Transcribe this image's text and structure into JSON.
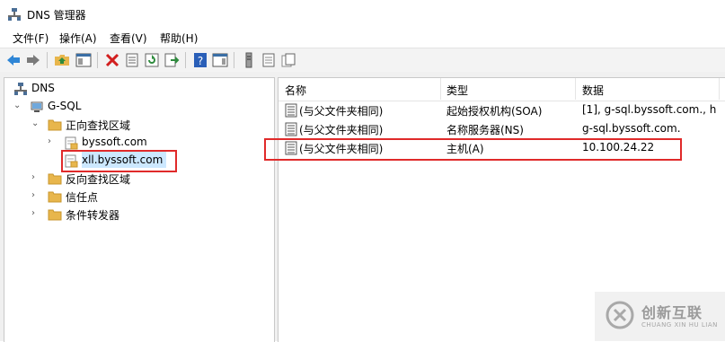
{
  "window": {
    "title": "DNS 管理器",
    "icon": "dns-manager-icon"
  },
  "menu": [
    {
      "label": "文件(F)"
    },
    {
      "label": "操作(A)"
    },
    {
      "label": "查看(V)"
    },
    {
      "label": "帮助(H)"
    }
  ],
  "toolbar": {
    "buttons": [
      {
        "icon": "back-arrow-icon"
      },
      {
        "icon": "forward-arrow-icon"
      },
      {
        "icon": "up-folder-icon"
      },
      {
        "icon": "show-hide-console-tree-icon"
      },
      {
        "icon": "delete-icon"
      },
      {
        "icon": "properties-icon"
      },
      {
        "icon": "refresh-icon"
      },
      {
        "icon": "export-list-icon"
      },
      {
        "icon": "help-icon"
      },
      {
        "icon": "show-action-pane-icon"
      },
      {
        "icon": "new-host-icon"
      },
      {
        "icon": "new-record-icon"
      },
      {
        "icon": "new-zone-icon"
      }
    ]
  },
  "tree": {
    "root": "DNS",
    "server": "G-SQL",
    "forward_zones": "正向查找区域",
    "zone1": "byssoft.com",
    "zone2": "xll.byssoft.com",
    "reverse_zones": "反向查找区域",
    "trust_points": "信任点",
    "conditional_forwarders": "条件转发器"
  },
  "list": {
    "columns": {
      "name": "名称",
      "type": "类型",
      "data": "数据"
    },
    "rows": [
      {
        "name": "(与父文件夹相同)",
        "type": "起始授权机构(SOA)",
        "data": "[1], g-sql.byssoft.com., h"
      },
      {
        "name": "(与父文件夹相同)",
        "type": "名称服务器(NS)",
        "data": "g-sql.byssoft.com."
      },
      {
        "name": "(与父文件夹相同)",
        "type": "主机(A)",
        "data": "10.100.24.22"
      }
    ]
  },
  "watermark": {
    "text": "创新互联",
    "sub": "CHUANG XIN HU LIAN"
  },
  "colors": {
    "highlight_box": "#e02a2a",
    "selection": "#cce8ff",
    "folder": "#e8b64c"
  }
}
